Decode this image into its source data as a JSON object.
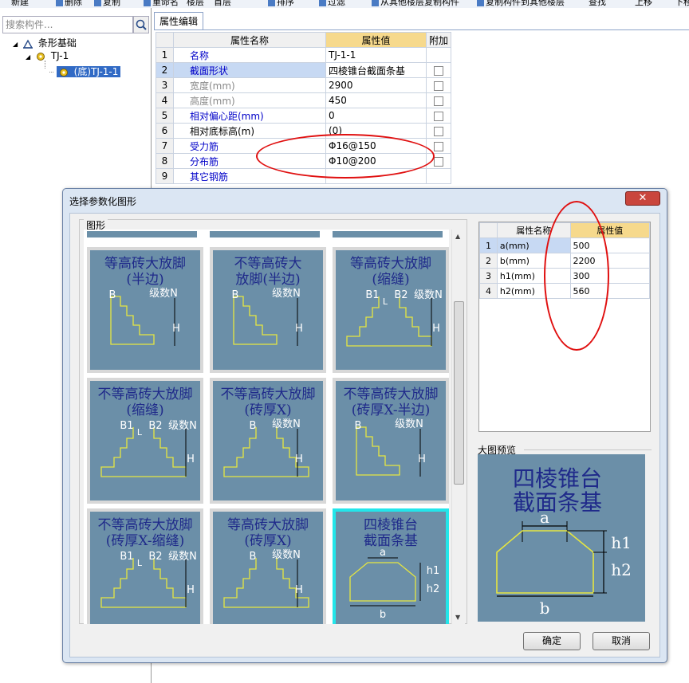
{
  "toolbar": {
    "items": [
      "新建",
      "删除",
      "复制",
      "重命名",
      "楼层",
      "首层",
      "排序",
      "过滤",
      "从其他楼层复制构件",
      "复制构件到其他楼层",
      "查找",
      "上移",
      "下移"
    ]
  },
  "left_panel": {
    "search_placeholder": "搜索构件...",
    "tree": {
      "root": "条形基础",
      "child": "TJ-1",
      "leaf": "(底)TJ-1-1"
    }
  },
  "properties": {
    "tab": "属性编辑",
    "headers": {
      "name": "属性名称",
      "value": "属性值",
      "extra": "附加"
    },
    "rows": [
      {
        "n": "1",
        "name": "名称",
        "value": "TJ-1-1",
        "style": "blue",
        "checkbox": false
      },
      {
        "n": "2",
        "name": "截面形状",
        "value": "四棱锥台截面条基",
        "style": "blue",
        "checkbox": true
      },
      {
        "n": "3",
        "name": "宽度(mm)",
        "value": "2900",
        "style": "gray",
        "checkbox": true
      },
      {
        "n": "4",
        "name": "高度(mm)",
        "value": "450",
        "style": "gray",
        "checkbox": true
      },
      {
        "n": "5",
        "name": "相对偏心距(mm)",
        "value": "0",
        "style": "blue",
        "checkbox": true
      },
      {
        "n": "6",
        "name": "相对底标高(m)",
        "value": "(0)",
        "style": "black",
        "checkbox": true
      },
      {
        "n": "7",
        "name": "受力筋",
        "value": "Φ16@150",
        "style": "blue",
        "checkbox": true
      },
      {
        "n": "8",
        "name": "分布筋",
        "value": "Φ10@200",
        "style": "blue",
        "checkbox": true
      },
      {
        "n": "9",
        "name": "其它钢筋",
        "value": "",
        "style": "blue",
        "checkbox": false
      }
    ]
  },
  "dialog": {
    "title": "选择参数化图形",
    "close": "✕",
    "group_label": "图形",
    "shapes": [
      {
        "t1": "等高砖大放脚",
        "t2": "(半边)",
        "labels": [
          "B",
          "级数N",
          "H"
        ],
        "selected": false
      },
      {
        "t1": "不等高砖大",
        "t2": "放脚(半边)",
        "labels": [
          "B",
          "级数N",
          "H"
        ],
        "selected": false
      },
      {
        "t1": "等高砖大放脚",
        "t2": "(缩缝)",
        "labels": [
          "B1",
          "B2",
          "L",
          "级数N",
          "H"
        ],
        "selected": false
      },
      {
        "t1": "不等高砖大放脚",
        "t2": "(缩缝)",
        "labels": [
          "B1",
          "B2",
          "L",
          "级数N",
          "H"
        ],
        "selected": false
      },
      {
        "t1": "不等高砖大放脚",
        "t2": "(砖厚X)",
        "labels": [
          "B",
          "级数N",
          "H"
        ],
        "selected": false
      },
      {
        "t1": "不等高砖大放脚",
        "t2": "(砖厚X-半边)",
        "labels": [
          "B",
          "级数N",
          "H"
        ],
        "selected": false
      },
      {
        "t1": "不等高砖大放脚",
        "t2": "(砖厚X-缩缝)",
        "labels": [
          "B1",
          "B2",
          "L",
          "级数N",
          "H"
        ],
        "selected": false
      },
      {
        "t1": "等高砖大放脚",
        "t2": "(砖厚X)",
        "labels": [
          "B",
          "级数N",
          "H"
        ],
        "selected": false
      },
      {
        "t1": "四棱锥台",
        "t2": "截面条基",
        "labels": [
          "a",
          "h1",
          "h2",
          "b"
        ],
        "selected": true
      }
    ],
    "param_table": {
      "headers": {
        "name": "属性名称",
        "value": "属性值"
      },
      "rows": [
        {
          "n": "1",
          "name": "a(mm)",
          "value": "500"
        },
        {
          "n": "2",
          "name": "b(mm)",
          "value": "2200"
        },
        {
          "n": "3",
          "name": "h1(mm)",
          "value": "300"
        },
        {
          "n": "4",
          "name": "h2(mm)",
          "value": "560"
        }
      ]
    },
    "preview": {
      "label": "大图预览",
      "title1": "四棱锥台",
      "title2": "截面条基",
      "labels": {
        "a": "a",
        "h1": "h1",
        "h2": "h2",
        "b": "b"
      }
    },
    "ok": "确定",
    "cancel": "取消"
  },
  "colors": {
    "tile_bg": "#6b8fa8",
    "tile_title": "#1f2a8a",
    "shape_line": "#e6e640",
    "selection_border": "#22e6ea",
    "annotation": "#e01010"
  }
}
